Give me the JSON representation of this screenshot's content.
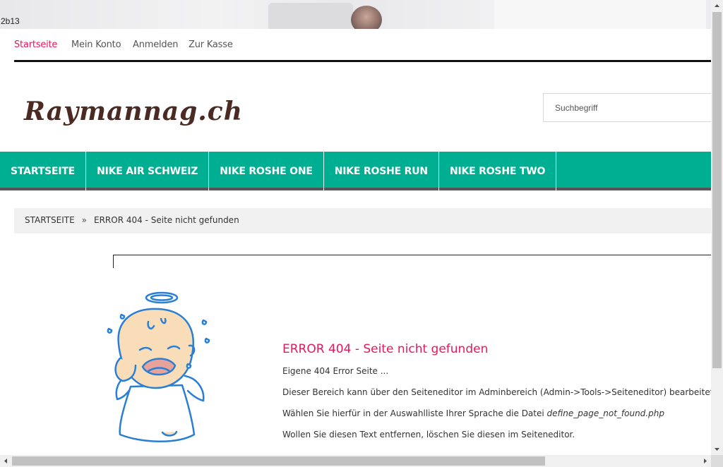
{
  "top_id": "2b13",
  "topnav": {
    "items": [
      {
        "label": "Startseite",
        "active": true
      },
      {
        "label": "Mein Konto",
        "active": false
      },
      {
        "label": "Anmelden",
        "active": false
      },
      {
        "label": "Zur Kasse",
        "active": false
      }
    ]
  },
  "logo": "Raymannag.ch",
  "search": {
    "placeholder": "Suchbegriff",
    "value": ""
  },
  "mainmenu": {
    "items": [
      "STARTSEITE",
      "NIKE AIR SCHWEIZ",
      "NIKE ROSHE ONE",
      "NIKE ROSHE RUN",
      "NIKE ROSHE TWO"
    ]
  },
  "breadcrumb": {
    "home": "STARTSEITE",
    "separator": "»",
    "current": "ERROR 404 - Seite nicht gefunden"
  },
  "content": {
    "title": "ERROR 404 - Seite nicht gefunden",
    "p1": "Eigene 404 Error Seite ...",
    "p2": "Dieser Bereich kann über den Seiteneditor im Adminbereich (Admin->Tools->Seiteneditor) bearbeitet werden.",
    "p3_prefix": "Wählen Sie hierfür in der Auswahlliste Ihrer Sprache die Datei ",
    "p3_file": "define_page_not_found.php",
    "p4": "Wollen Sie diesen Text entfernen, löschen Sie diesen im Seiteneditor."
  },
  "colors": {
    "accent": "#e4195b",
    "menu_bg": "#00ae92",
    "breadcrumb_bg": "#f1f1f1"
  },
  "icons": {
    "baby": "crying-baby-angel-illustration"
  }
}
